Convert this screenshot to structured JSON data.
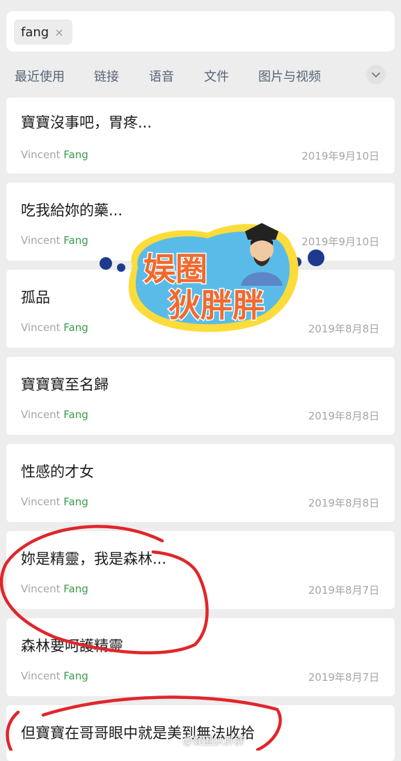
{
  "search": {
    "query_chip": "fang",
    "clear_glyph": "×"
  },
  "filters": {
    "items": [
      "最近使用",
      "链接",
      "语音",
      "文件",
      "图片与视频"
    ],
    "expand_icon": "chevron-down-icon"
  },
  "results": [
    {
      "title": "寶寶沒事吧，胃疼...",
      "sender_first": "Vincent",
      "sender_highlight": "Fang",
      "date": "2019年9月10日"
    },
    {
      "title": "吃我給妳的藥...",
      "sender_first": "Vincent",
      "sender_highlight": "Fang",
      "date": "2019年9月10日"
    },
    {
      "title": "孤品",
      "sender_first": "Vincent",
      "sender_highlight": "Fang",
      "date": "2019年8月8日"
    },
    {
      "title": "寶寶寶至名歸",
      "sender_first": "Vincent",
      "sender_highlight": "Fang",
      "date": "2019年8月8日"
    },
    {
      "title": "性感的才女",
      "sender_first": "Vincent",
      "sender_highlight": "Fang",
      "date": "2019年8月8日"
    },
    {
      "title": "妳是精靈，我是森林...",
      "sender_first": "Vincent",
      "sender_highlight": "Fang",
      "date": "2019年8月7日"
    },
    {
      "title": "森林要呵護精靈",
      "sender_first": "Vincent",
      "sender_highlight": "Fang",
      "date": "2019年8月7日"
    },
    {
      "title": "但寶寶在哥哥眼中就是美到無法收拾",
      "sender_first": "",
      "sender_highlight": "",
      "date": ""
    }
  ],
  "logo_text": {
    "line1": "娱圈",
    "line2": "狄胖胖"
  },
  "watermark": "@娱圈狄胖胖",
  "colors": {
    "background": "#ededed",
    "card": "#ffffff",
    "highlight": "#3a9a4c",
    "filter_text": "#586378",
    "annotation": "#e0262b"
  }
}
